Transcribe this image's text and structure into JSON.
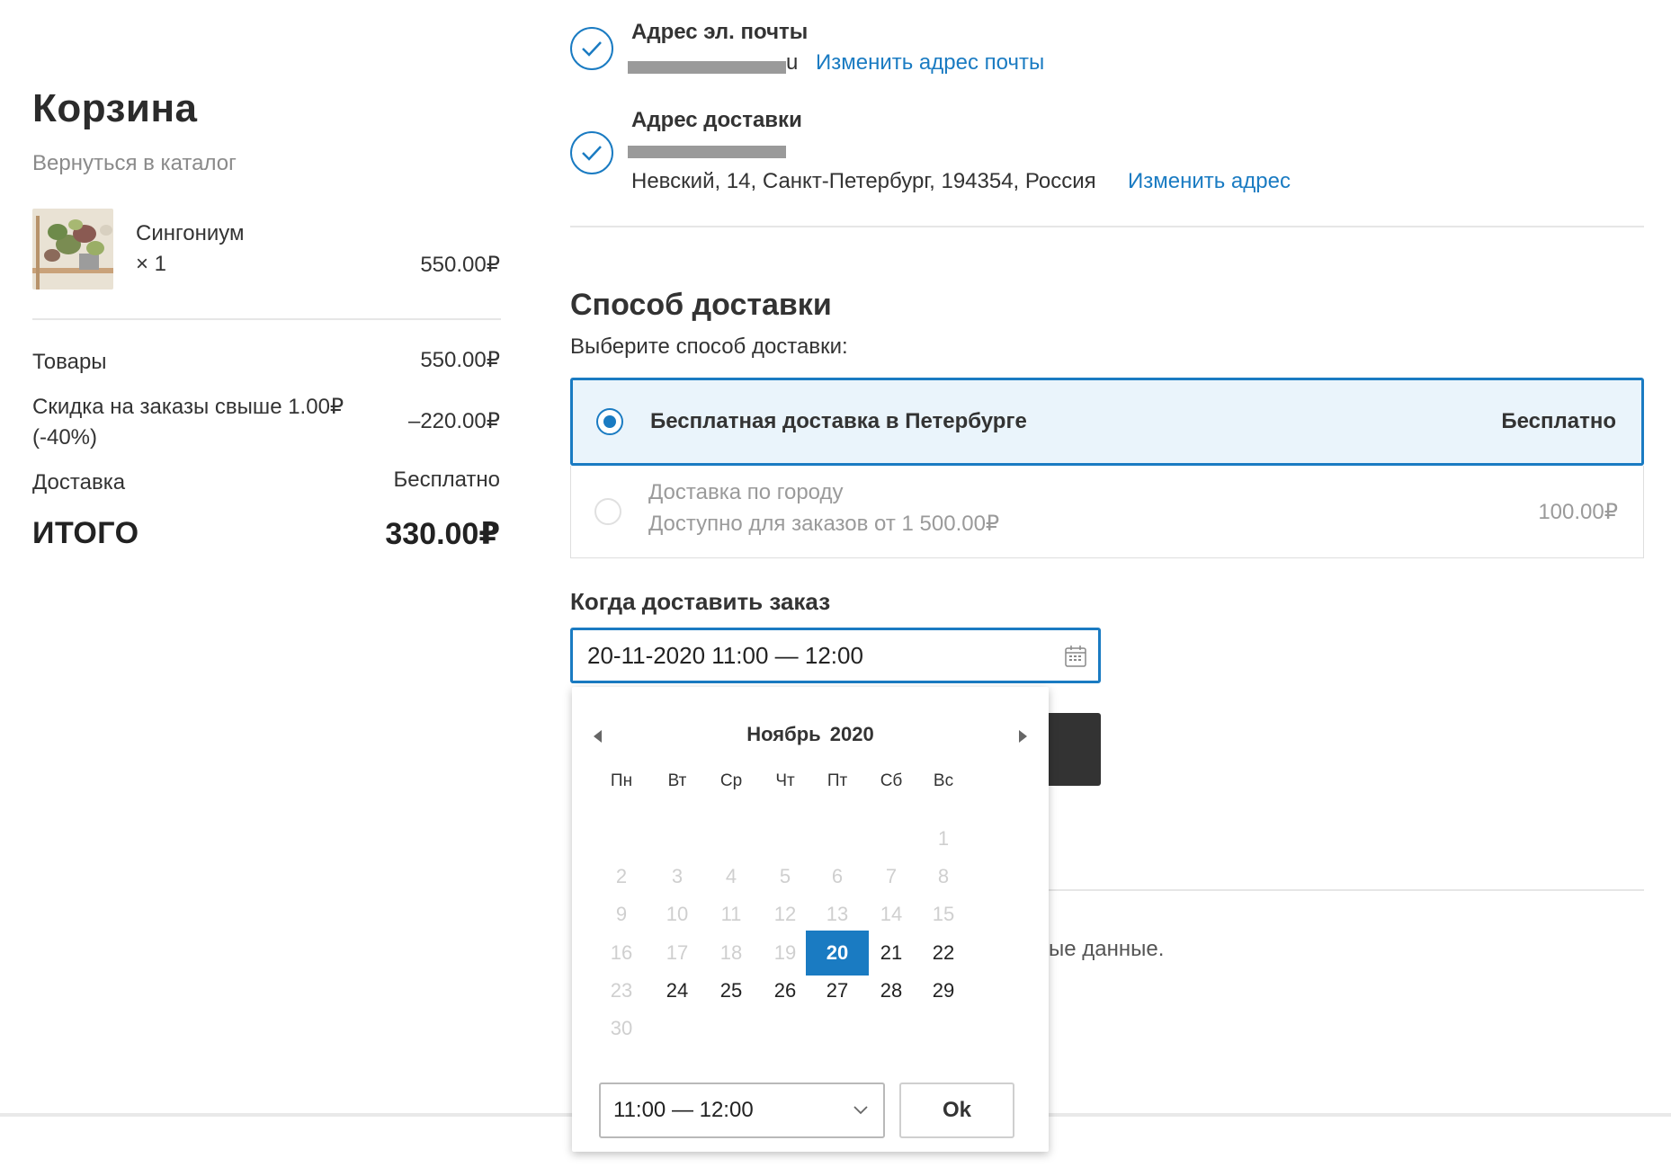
{
  "cart": {
    "title": "Корзина",
    "back_link": "Вернуться в каталог",
    "item": {
      "name": "Сингониум",
      "qty": "× 1",
      "price": "550.00₽"
    },
    "summary": {
      "goods_label": "Товары",
      "goods_value": "550.00₽",
      "discount_label_line1": "Скидка на заказы свыше 1.00₽",
      "discount_label_line2": "(-40%)",
      "discount_value": "–220.00₽",
      "delivery_label": "Доставка",
      "delivery_value": "Бесплатно",
      "total_label": "ИТОГО",
      "total_value": "330.00₽"
    }
  },
  "checkout": {
    "email_step": {
      "title": "Адрес эл. почты",
      "visible_suffix": "u",
      "change_link": "Изменить адрес почты"
    },
    "address_step": {
      "title": "Адрес доставки",
      "address_line": "Невский, 14, Санкт-Петербург, 194354, Россия",
      "change_link": "Изменить адрес"
    },
    "shipping": {
      "heading": "Способ доставки",
      "subheading": "Выберите способ доставки:",
      "options": [
        {
          "label": "Бесплатная доставка в Петербурге",
          "price": "Бесплатно",
          "selected": true
        },
        {
          "label": "Доставка по городу",
          "note": "Доступно для заказов от 1 500.00₽",
          "price": "100.00₽",
          "selected": false
        }
      ]
    },
    "when": {
      "heading": "Когда доставить заказ",
      "value": "20-11-2020 11:00 — 12:00"
    },
    "consent_fragment": "ые данные.",
    "colors": {
      "accent": "#1a7bc2",
      "selected_bg": "#eaf4fb",
      "disabled_text": "#cfcfcf"
    }
  },
  "calendar": {
    "month": "Ноябрь",
    "year": "2020",
    "weekdays": [
      "Пн",
      "Вт",
      "Ср",
      "Чт",
      "Пт",
      "Сб",
      "Вс"
    ],
    "weeks": [
      [
        null,
        null,
        null,
        null,
        null,
        null,
        "1"
      ],
      [
        "2",
        "3",
        "4",
        "5",
        "6",
        "7",
        "8"
      ],
      [
        "9",
        "10",
        "11",
        "12",
        "13",
        "14",
        "15"
      ],
      [
        "16",
        "17",
        "18",
        "19",
        "20",
        "21",
        "22"
      ],
      [
        "23",
        "24",
        "25",
        "26",
        "27",
        "28",
        "29"
      ],
      [
        "30",
        null,
        null,
        null,
        null,
        null,
        null
      ]
    ],
    "disabled_days": [
      "1",
      "2",
      "3",
      "4",
      "5",
      "6",
      "7",
      "8",
      "9",
      "10",
      "11",
      "12",
      "13",
      "14",
      "15",
      "16",
      "17",
      "18",
      "19",
      "23",
      "30"
    ],
    "selected_day": "20",
    "time_slot": "11:00 — 12:00",
    "ok_label": "Ok"
  },
  "icons": {
    "check": "check-icon",
    "calendar": "calendar-icon",
    "chevron": "chevron-down-icon",
    "prev": "chevron-left-icon",
    "next": "chevron-right-icon"
  }
}
